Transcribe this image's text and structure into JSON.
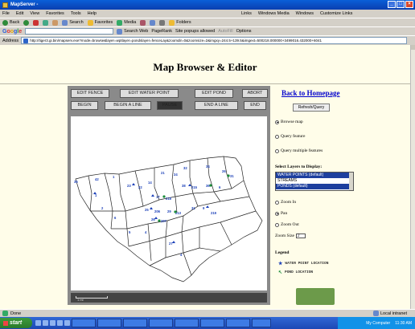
{
  "window": {
    "title": "MapServer -"
  },
  "menu": {
    "items": [
      "File",
      "Edit",
      "View",
      "Favorites",
      "Tools",
      "Help"
    ],
    "links_label": "Links",
    "links": [
      "Windows Media",
      "Windows",
      "Customize Links"
    ]
  },
  "toolbar": {
    "back": "Back",
    "search": "Search",
    "favorites": "Favorites",
    "media": "Media",
    "folders": "Folders"
  },
  "google": {
    "logo": "Google",
    "search_web": "Search Web",
    "pagerank": "PageRank",
    "popups": "Site popups allowed",
    "autofill": "AutoFill",
    "options": "Options"
  },
  "address": {
    "label": "Address",
    "url": "http://tiger3.gi.bin/mapserv.exe?mode=browse&layer=wptlayer=pondslayer=fenceLay&zoomdir=0&zoomsize=2&imgxy=244.5+139.5&imgext=500218.000000+3499016.432000+6041"
  },
  "page": {
    "title": "Map Browser & Editor",
    "buttons": {
      "edit_fence": "EDIT FENCE",
      "edit_water_point": "EDIT WATER POINT",
      "edit_pond": "EDIT POND",
      "abort": "ABORT",
      "begin": "BEGIN",
      "begin_a_line": "BEGIN A LINE",
      "pause": "PAUSE",
      "end_a_line": "END A LINE",
      "end": "END"
    },
    "scale_label": "1 mi"
  },
  "sidebar": {
    "home_link": "Back to Homepage",
    "refresh": "Refresh/Query",
    "modes": [
      "Browse map",
      "Query feature",
      "Query multiple features"
    ],
    "select_layers_label": "Select Layers to Display:",
    "layers": [
      "WATER POINTS (default)",
      "STREAMS",
      "PONDS (default)"
    ],
    "zoom": [
      "Zoom In",
      "Pan",
      "Zoom Out"
    ],
    "zoom_size_label": "Zoom Size",
    "zoom_size_value": "2",
    "legend_label": "Legend",
    "legend_items": [
      "WATER POINT LOCATION",
      "POND LOCATION"
    ]
  },
  "status": {
    "left": "Done",
    "right": "Local intranet"
  },
  "taskbar": {
    "start": "start",
    "items": [
      "",
      "",
      "",
      "",
      "",
      "",
      "",
      ""
    ],
    "tray": "My Computer",
    "time": "11:30 AM"
  },
  "map_labels": [
    "36",
    "42",
    "1",
    "23",
    "22",
    "14",
    "21",
    "24",
    "32",
    "34",
    "26",
    "31",
    "38",
    "215",
    "36",
    "6",
    "17",
    "218",
    "25",
    "206",
    "29",
    "213",
    "31",
    "9",
    "219",
    "1",
    "2",
    "6",
    "26",
    "207",
    "5",
    "4",
    "27",
    "4"
  ],
  "colors": {
    "accent": "#0a3fb0",
    "link": "#0000cc",
    "page_bg": "#fffde9",
    "pond": "#1a8c3a",
    "waterpoint": "#1a3fb8"
  }
}
